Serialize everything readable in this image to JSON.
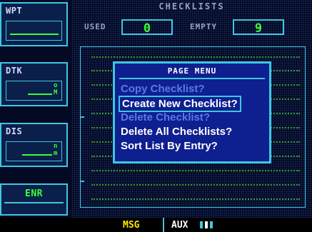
{
  "header": {
    "title": "CHECKLISTS"
  },
  "stats": {
    "used_label": "USED",
    "used_value": "0",
    "empty_label": "EMPTY",
    "empty_value": "9"
  },
  "fields": {
    "wpt_label": "WPT",
    "dtk_label": "DTK",
    "dtk_unit_top": "o",
    "dtk_unit_bottom": "M",
    "dis_label": "DIS",
    "dis_unit_top": "n",
    "dis_unit_bottom": "m",
    "mode_label": "ENR"
  },
  "menu": {
    "title": "PAGE MENU",
    "items": [
      {
        "label": "Copy Checklist?",
        "state": "disabled"
      },
      {
        "label": "Create New Checklist?",
        "state": "selected"
      },
      {
        "label": "Delete Checklist?",
        "state": "disabled"
      },
      {
        "label": "Delete All Checklists?",
        "state": "enabled"
      },
      {
        "label": "Sort List By Entry?",
        "state": "enabled"
      }
    ]
  },
  "status_bar": {
    "msg_label": "MSG",
    "aux_label": "AUX"
  },
  "colors": {
    "accent": "#3fc6e0",
    "data_green": "#39ff39",
    "menu_bg": "#0e1f90",
    "msg_yellow": "#ffe600"
  }
}
